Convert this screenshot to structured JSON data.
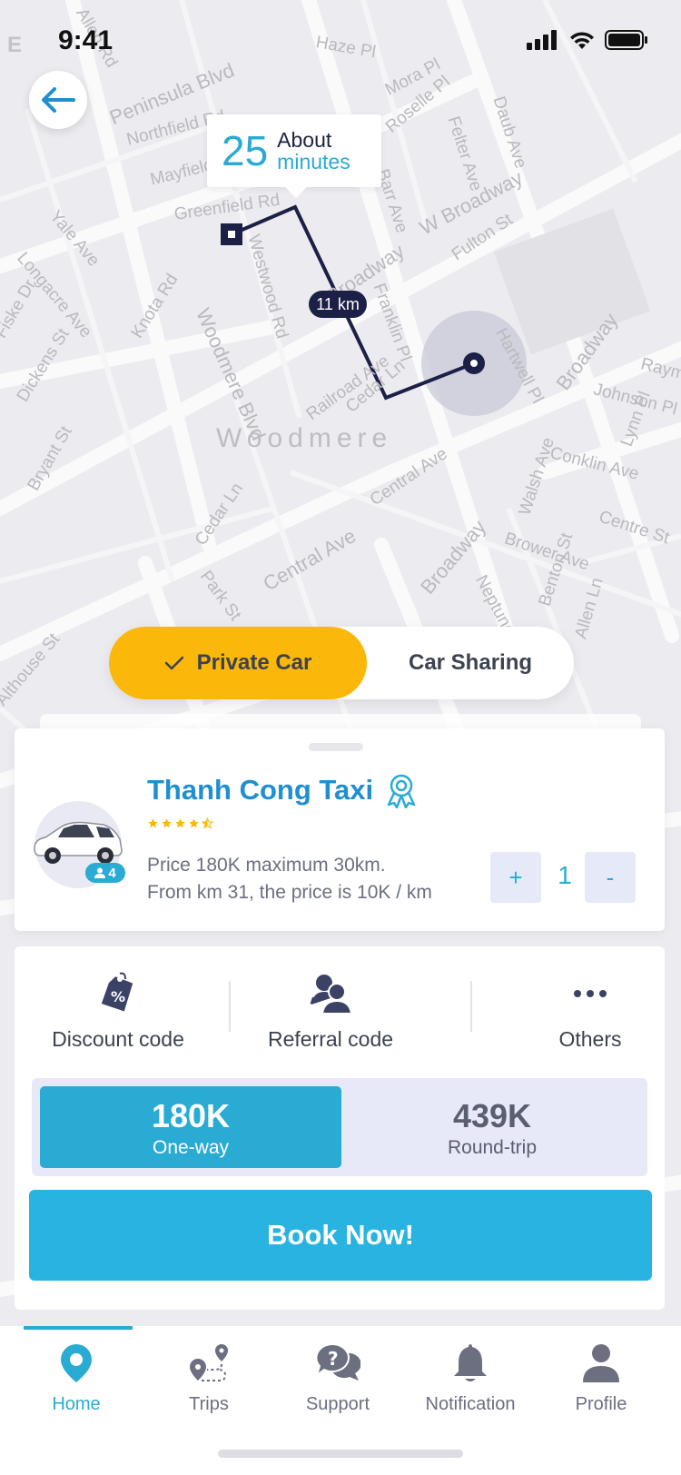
{
  "status_bar": {
    "time": "9:41",
    "left_edge_letter": "E"
  },
  "map": {
    "district": "Woodmere",
    "streets": [
      "Allen Rd",
      "Haze Pl",
      "Peninsula Blvd",
      "Northfield Rd",
      "Mayfield Rd",
      "Greenfield Rd",
      "Mora Pl",
      "Roselle Pl",
      "Daub Ave",
      "Felter Ave",
      "Barr Ave",
      "W Broadway",
      "Yale Ave",
      "Longacre Ave",
      "Fiske Dr",
      "Dickens St",
      "Knota Rd",
      "Woodmere Blvd",
      "Westwood Rd",
      "Franklin Pl",
      "Broadway",
      "Fulton St",
      "Hartwell Pl",
      "Broadway",
      "Raymo",
      "Johnson Pl",
      "Lynn Pl",
      "Railroad Ave",
      "Cedar Ln",
      "Conklin Ave",
      "Bryant St",
      "Central Ave",
      "Cedar Ln",
      "Park St",
      "Central Ave",
      "Brower Ave",
      "Centre St",
      "Walsh Ave",
      "Broadway",
      "Neptune Ave",
      "Benton St",
      "Allen Ln",
      "Althouse St"
    ]
  },
  "eta": {
    "value": "25",
    "line1": "About",
    "line2": "minutes"
  },
  "route": {
    "distance": "11 km"
  },
  "ride_type": {
    "active": "Private Car",
    "inactive": "Car Sharing"
  },
  "driver": {
    "name": "Thanh Cong Taxi",
    "rating": 4.5,
    "seats": "4",
    "price_line1": "Price 180K maximum 30km.",
    "price_line2": "From km 31, the price is 10K / km",
    "quantity": "1",
    "plus_label": "+",
    "minus_label": "-"
  },
  "options": {
    "discount": "Discount code",
    "referral": "Referral code",
    "others": "Others"
  },
  "fare": {
    "oneway_amount": "180K",
    "oneway_label": "One-way",
    "round_amount": "439K",
    "round_label": "Round-trip"
  },
  "book_button": "Book Now!",
  "nav": {
    "home": "Home",
    "trips": "Trips",
    "support": "Support",
    "notification": "Notification",
    "profile": "Profile"
  },
  "colors": {
    "accent": "#29abd4",
    "active_segment": "#fbb80b",
    "route": "#1c1f46",
    "name": "#1f8fd1",
    "star": "#fbb80b"
  }
}
